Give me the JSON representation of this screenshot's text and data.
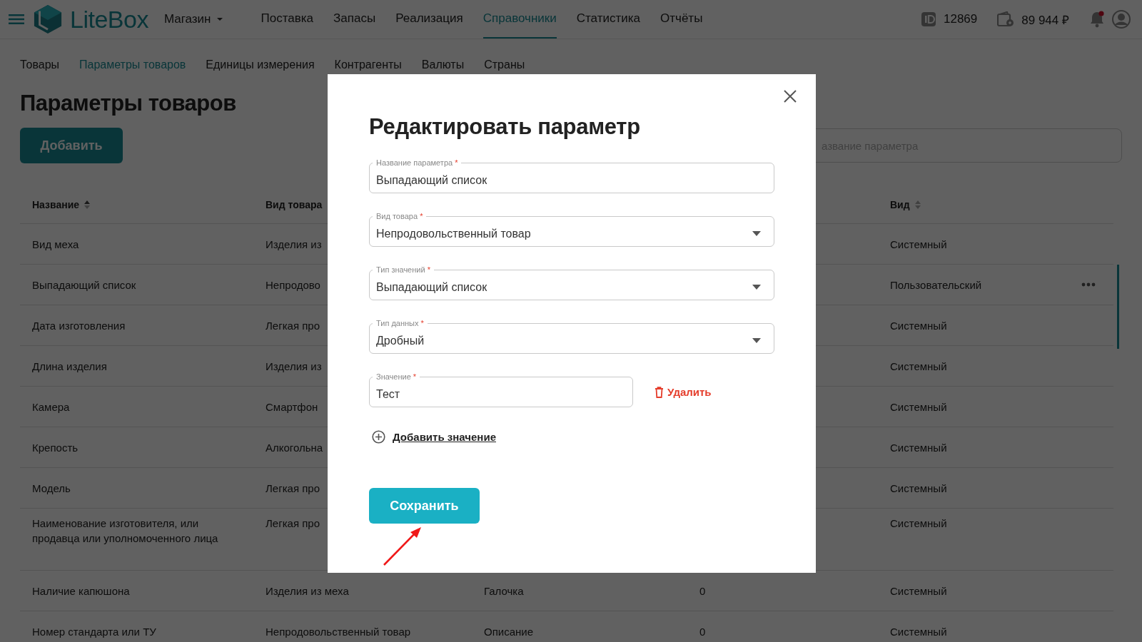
{
  "header": {
    "logo": "LiteBox",
    "store": "Магазин",
    "nav": [
      {
        "label": "Поставка",
        "selected": false
      },
      {
        "label": "Запасы",
        "selected": false
      },
      {
        "label": "Реализация",
        "selected": false
      },
      {
        "label": "Справочники",
        "selected": true
      },
      {
        "label": "Статистика",
        "selected": false
      },
      {
        "label": "Отчёты",
        "selected": false
      }
    ],
    "id_value": "12869",
    "balance": "89 944 ₽",
    "has_notifications": true
  },
  "subnav": [
    {
      "label": "Товары",
      "selected": false
    },
    {
      "label": "Параметры товаров",
      "selected": true
    },
    {
      "label": "Единицы измерения",
      "selected": false
    },
    {
      "label": "Контрагенты",
      "selected": false
    },
    {
      "label": "Валюты",
      "selected": false
    },
    {
      "label": "Страны",
      "selected": false
    }
  ],
  "page": {
    "title": "Параметры товаров",
    "add_button": "Добавить",
    "search_placeholder": "азвание параметра"
  },
  "table": {
    "columns": {
      "name": "Название",
      "product_type": "Вид товара",
      "kind": "Вид"
    },
    "rows": [
      {
        "name": "Вид меха",
        "product_type": "Изделия из",
        "kind": "Системный",
        "has_menu": false
      },
      {
        "name": "Выпадающий список",
        "product_type": "Непродово",
        "kind": "Пользовательский",
        "has_menu": true
      },
      {
        "name": "Дата изготовления",
        "product_type": "Легкая про",
        "kind": "Системный",
        "has_menu": false
      },
      {
        "name": "Длина изделия",
        "product_type": "Изделия из",
        "kind": "Системный",
        "has_menu": false
      },
      {
        "name": "Камера",
        "product_type": "Смартфон",
        "kind": "Системный",
        "has_menu": false
      },
      {
        "name": "Крепость",
        "product_type": "Алкогольна",
        "kind": "Системный",
        "has_menu": false
      },
      {
        "name": "Модель",
        "product_type": "Легкая про",
        "kind": "Системный",
        "has_menu": false
      },
      {
        "name": "Наименование изготовителя, или продавца или уполномоченного лица",
        "product_type": "Легкая про",
        "kind": "Системный",
        "has_menu": false
      },
      {
        "name": "Наличие капюшона",
        "product_type": "Изделия из меха",
        "column_3": "Галочка",
        "column_4": "0",
        "kind": "Системный",
        "has_menu": false
      },
      {
        "name": "Номер стандарта или ТУ",
        "product_type": "Непродовольственный товар",
        "column_3": "Описание",
        "column_4": "0",
        "kind": "Системный",
        "has_menu": false
      }
    ]
  },
  "modal": {
    "title": "Редактировать параметр",
    "fields": [
      {
        "kind": "text",
        "label": "Название параметра",
        "required_mark": "*",
        "value": "Выпадающий список"
      },
      {
        "kind": "select",
        "label": "Вид товара",
        "required_mark": "*",
        "value": "Непродовольственный товар"
      },
      {
        "kind": "select",
        "label": "Тип значений",
        "required_mark": "*",
        "value": "Выпадающий список"
      },
      {
        "kind": "select",
        "label": "Тип данных",
        "required_mark": "*",
        "value": "Дробный"
      }
    ],
    "values": [
      {
        "label": "Значение",
        "required_mark": "*",
        "value": "Тест",
        "delete": "Удалить"
      }
    ],
    "add_value": "Добавить значение",
    "save_button": "Сохранить"
  }
}
